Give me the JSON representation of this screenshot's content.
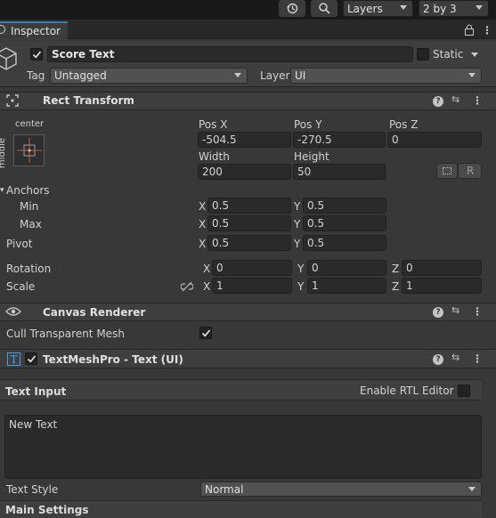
{
  "toolbar": {
    "history_icon": "history-icon",
    "search_icon": "search-icon",
    "layers_label": "Layers",
    "layout_label": "2 by 3"
  },
  "tab": {
    "title": "Inspector"
  },
  "object": {
    "name": "Score Text",
    "active": true,
    "static_label": "Static",
    "tag_label": "Tag",
    "tag_value": "Untagged",
    "layer_label": "Layer",
    "layer_value": "UI"
  },
  "rect_transform": {
    "title": "Rect Transform",
    "anchor_h": "center",
    "anchor_v": "middle",
    "pos_x_label": "Pos X",
    "pos_x": "-504.5",
    "pos_y_label": "Pos Y",
    "pos_y": "-270.5",
    "pos_z_label": "Pos Z",
    "pos_z": "0",
    "width_label": "Width",
    "width": "200",
    "height_label": "Height",
    "height": "50",
    "raw_button": "R",
    "anchors_label": "Anchors",
    "min_label": "Min",
    "min_x": "0.5",
    "min_y": "0.5",
    "max_label": "Max",
    "max_x": "0.5",
    "max_y": "0.5",
    "pivot_label": "Pivot",
    "pivot_x": "0.5",
    "pivot_y": "0.5",
    "rotation_label": "Rotation",
    "rot_x": "0",
    "rot_y": "0",
    "rot_z": "0",
    "scale_label": "Scale",
    "scale_x": "1",
    "scale_y": "1",
    "scale_z": "1",
    "x": "X",
    "y": "Y",
    "z": "Z"
  },
  "canvas_renderer": {
    "title": "Canvas Renderer",
    "cull_label": "Cull Transparent Mesh",
    "cull": true
  },
  "tmp": {
    "title": "TextMeshPro - Text (UI)",
    "enabled": true,
    "text_input_label": "Text Input",
    "rtl_label": "Enable RTL Editor",
    "text_value": "New Text",
    "text_style_label": "Text Style",
    "text_style_value": "Normal",
    "main_settings_label": "Main Settings"
  },
  "colors": {
    "background": "#383838",
    "field": "#2a2a2a",
    "header": "#3e3e3e",
    "accent_blue": "#4a9eea"
  }
}
